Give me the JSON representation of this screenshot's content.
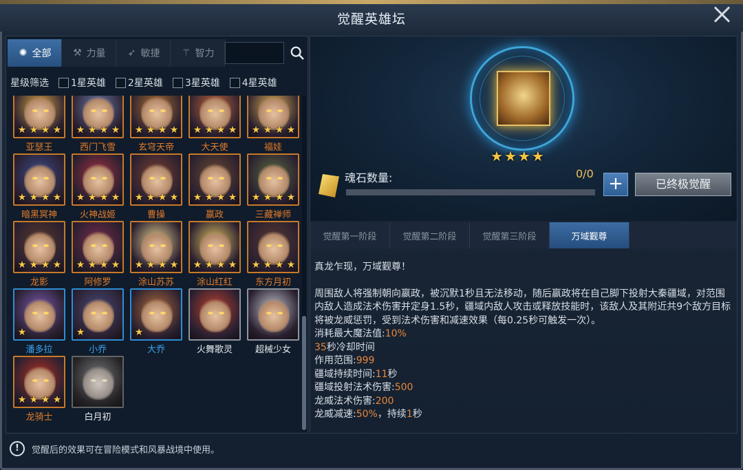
{
  "window": {
    "title": "觉醒英雄坛"
  },
  "filters": {
    "tabs": [
      {
        "label": "全部",
        "icon": "all-icon",
        "active": true
      },
      {
        "label": "力量",
        "icon": "strength-icon",
        "active": false
      },
      {
        "label": "敏捷",
        "icon": "agility-icon",
        "active": false
      },
      {
        "label": "智力",
        "icon": "intelligence-icon",
        "active": false
      }
    ],
    "search_placeholder": "",
    "star_filter_label": "星级筛选",
    "star_options": [
      "1星英雄",
      "2星英雄",
      "3星英雄",
      "4星英雄"
    ]
  },
  "heroes": [
    {
      "name": "亚瑟王",
      "stars": 4,
      "frame": "orange"
    },
    {
      "name": "西门飞雪",
      "stars": 4,
      "frame": "orange"
    },
    {
      "name": "玄穹天帝",
      "stars": 4,
      "frame": "orange"
    },
    {
      "name": "大天使",
      "stars": 4,
      "frame": "orange"
    },
    {
      "name": "福娃",
      "stars": 4,
      "frame": "orange"
    },
    {
      "name": "暗黑冥神",
      "stars": 4,
      "frame": "orange"
    },
    {
      "name": "火神战姬",
      "stars": 4,
      "frame": "orange"
    },
    {
      "name": "曹操",
      "stars": 4,
      "frame": "orange"
    },
    {
      "name": "嬴政",
      "stars": 4,
      "frame": "orange"
    },
    {
      "name": "三藏禅师",
      "stars": 4,
      "frame": "orange"
    },
    {
      "name": "龙影",
      "stars": 4,
      "frame": "orange"
    },
    {
      "name": "阿修罗",
      "stars": 4,
      "frame": "orange"
    },
    {
      "name": "涂山苏苏",
      "stars": 4,
      "frame": "orange"
    },
    {
      "name": "涂山红红",
      "stars": 4,
      "frame": "orange"
    },
    {
      "name": "东方月初",
      "stars": 4,
      "frame": "orange"
    },
    {
      "name": "潘多拉",
      "stars": 1,
      "frame": "blue"
    },
    {
      "name": "小乔",
      "stars": 1,
      "frame": "blue"
    },
    {
      "name": "大乔",
      "stars": 1,
      "frame": "blue"
    },
    {
      "name": "火舞歌灵",
      "stars": 0,
      "frame": "white"
    },
    {
      "name": "超械少女",
      "stars": 0,
      "frame": "white"
    },
    {
      "name": "龙骑士",
      "stars": 4,
      "frame": "orange"
    },
    {
      "name": "白月初",
      "stars": 0,
      "frame": "gray"
    }
  ],
  "notice": "觉醒后的效果可在冒险模式和风暴战境中使用。",
  "selected_hero": {
    "stars": 4,
    "soul_stone_label": "魂石数量:",
    "soul_stone_count": "0/0",
    "soul_stone_progress": 0,
    "plus_label": "+",
    "awaken_button": "已终极觉醒"
  },
  "stage_tabs": [
    {
      "label": "觉醒第一阶段",
      "active": false
    },
    {
      "label": "觉醒第二阶段",
      "active": false
    },
    {
      "label": "觉醒第三阶段",
      "active": false
    },
    {
      "label": "万域觐尊",
      "active": true
    }
  ],
  "skill": {
    "title": "真龙乍现，万域觐尊！",
    "description": "周围敌人将强制朝向嬴政，被沉默1秒且无法移动，随后嬴政将在自己脚下投射大秦疆域，对范围内敌人造成法术伤害并定身1.5秒，疆域内敌人攻击或释放技能时，该敌人及其附近共9个敌方目标将被龙威惩罚，受到法术伤害和减速效果（每0.25秒可触发一次）。",
    "stats": {
      "mana_cost_label": "消耗最大魔法值:",
      "mana_cost_value": "10%",
      "cooldown_value": "35",
      "cooldown_label": "秒冷却时间",
      "range_label": "作用范围:",
      "range_value": "999",
      "domain_duration_label": "疆域持续时间:",
      "domain_duration_value": "11",
      "domain_duration_unit": "秒",
      "domain_damage_label": "疆域投射法术伤害:",
      "domain_damage_value": "500",
      "dragon_damage_label": "龙威法术伤害:",
      "dragon_damage_value": "200",
      "dragon_slow_label": "龙威减速:",
      "dragon_slow_value": "50%",
      "dragon_slow_mid": "，持续",
      "dragon_slow_duration": "1",
      "dragon_slow_unit": "秒"
    }
  }
}
